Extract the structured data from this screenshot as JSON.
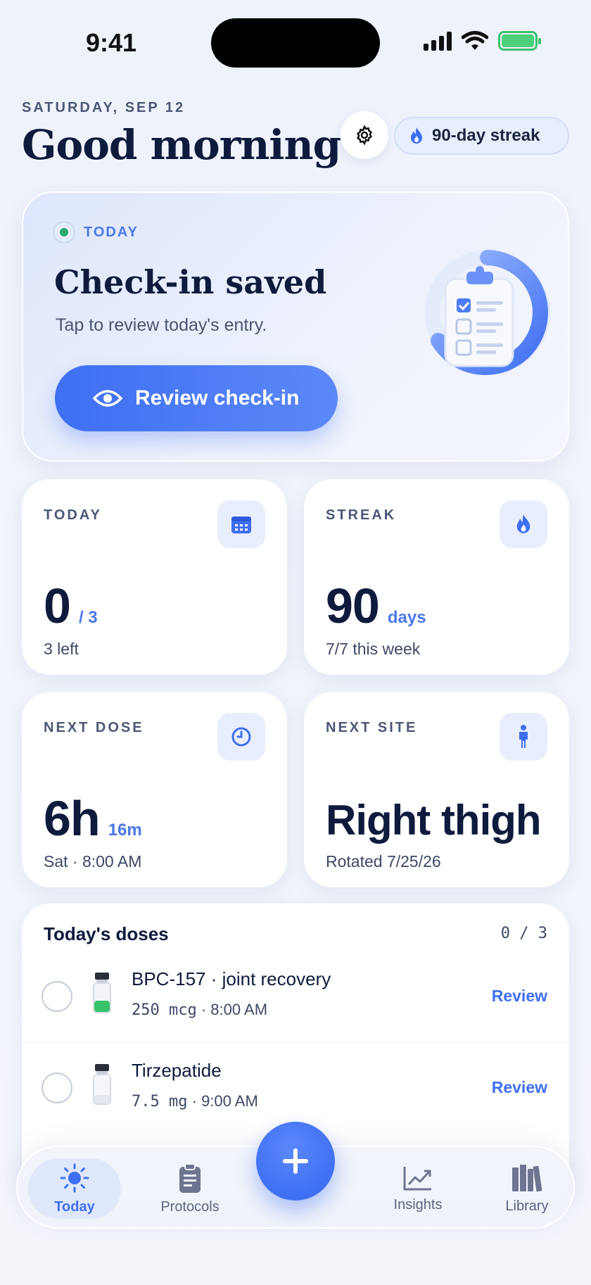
{
  "status_bar": {
    "time": "9:41"
  },
  "header": {
    "date": "SATURDAY, SEP 12",
    "greeting": "Good morning",
    "streak_pill": "90-day streak"
  },
  "hero": {
    "tag": "TODAY",
    "title": "Check-in saved",
    "subtitle": "Tap to review today's entry.",
    "button_label": "Review check-in"
  },
  "stats": {
    "today": {
      "label": "TODAY",
      "value": "0",
      "unit": "/ 3",
      "foot": "3 left",
      "icon": "calendar-icon"
    },
    "streak": {
      "label": "STREAK",
      "value": "90",
      "unit": "days",
      "foot": "7/7 this week",
      "icon": "flame-icon"
    },
    "next_dose": {
      "label": "NEXT DOSE",
      "value": "6h",
      "unit": "16m",
      "foot": "Sat · 8:00 AM",
      "icon": "clock-icon"
    },
    "next_site": {
      "label": "NEXT SITE",
      "value": "Right thigh",
      "foot": "Rotated 7/25/26",
      "icon": "person-icon"
    }
  },
  "doses": {
    "title": "Today's doses",
    "count": "0 / 3",
    "items": [
      {
        "name": "BPC-157 · joint recovery",
        "amount": "250 mcg",
        "time": "8:00 AM",
        "action": "Review",
        "vial_color": "#38c36a"
      },
      {
        "name": "Tirzepatide",
        "amount": "7.5 mg",
        "time": "9:00 AM",
        "action": "Review",
        "vial_color": "#dfe3ea"
      }
    ]
  },
  "tabbar": {
    "tabs": [
      {
        "label": "Today",
        "icon": "sun-icon",
        "active": true
      },
      {
        "label": "Protocols",
        "icon": "clipboard-icon",
        "active": false
      },
      {
        "label": "Insights",
        "icon": "chart-icon",
        "active": false
      },
      {
        "label": "Library",
        "icon": "books-icon",
        "active": false
      }
    ],
    "fab_label": "+"
  },
  "colors": {
    "accent": "#3f6ff3",
    "text": "#0f1b3d",
    "success": "#2ea86a"
  }
}
